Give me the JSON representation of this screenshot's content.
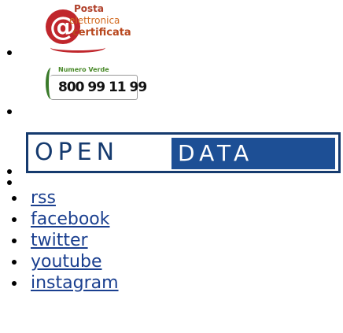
{
  "logos": {
    "pec": {
      "at_symbol": "@",
      "line1": "Posta",
      "line2": "elettronica",
      "line3": "certificata",
      "color": "#c0262c"
    },
    "numero_verde": {
      "title": "Numero Verde",
      "number": "800 99 11 99",
      "color": "#3a7a2a"
    },
    "open_data": {
      "open": "OPEN",
      "data": "DATA",
      "color": "#1d4f95"
    }
  },
  "social_links": [
    {
      "label": "rss"
    },
    {
      "label": "facebook"
    },
    {
      "label": "twitter"
    },
    {
      "label": "youtube"
    },
    {
      "label": "instagram"
    }
  ],
  "link_color": "#1a3f8f"
}
